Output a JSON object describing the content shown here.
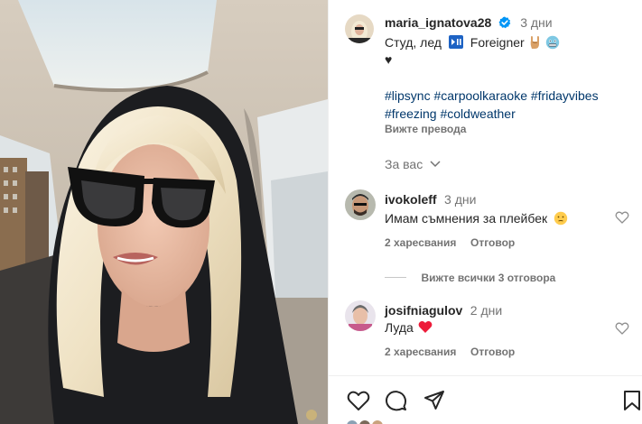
{
  "post": {
    "author": "maria_ignatova28",
    "verified": true,
    "time": "3 дни",
    "caption_line1_text": "Студ, лед",
    "caption_play_icon": "play-pause-icon",
    "caption_band": "Foreigner",
    "caption_emojis": [
      "rock-hand-emoji",
      "freezing-face-emoji"
    ],
    "caption_line2": "♥",
    "hashtags_line1": "#lipsync #carpoolkaraoke #fridayvibes",
    "hashtags_line2": "#freezing #coldweather",
    "translate_label": "Вижте превода"
  },
  "for_you_label": "За вас",
  "comments": [
    {
      "user": "ivokoleff",
      "time": "3 дни",
      "text": "Имам съмнения за плейбек",
      "emoji": "thinking-face-emoji",
      "likes_label": "2 харесвания",
      "reply_label": "Отговор",
      "view_replies_label": "Вижте всички 3 отговора"
    },
    {
      "user": "josifniagulov",
      "time": "2 дни",
      "text": "Луда",
      "emoji": "red-heart-emoji",
      "likes_label": "2 харесвания",
      "reply_label": "Отговор"
    }
  ],
  "colors": {
    "link": "#00376b",
    "secondary": "#737373",
    "verified": "#0095f6",
    "heart_emoji": "#ed1c3a"
  },
  "actions": [
    "heart-icon",
    "comment-icon",
    "share-icon",
    "bookmark-icon"
  ]
}
